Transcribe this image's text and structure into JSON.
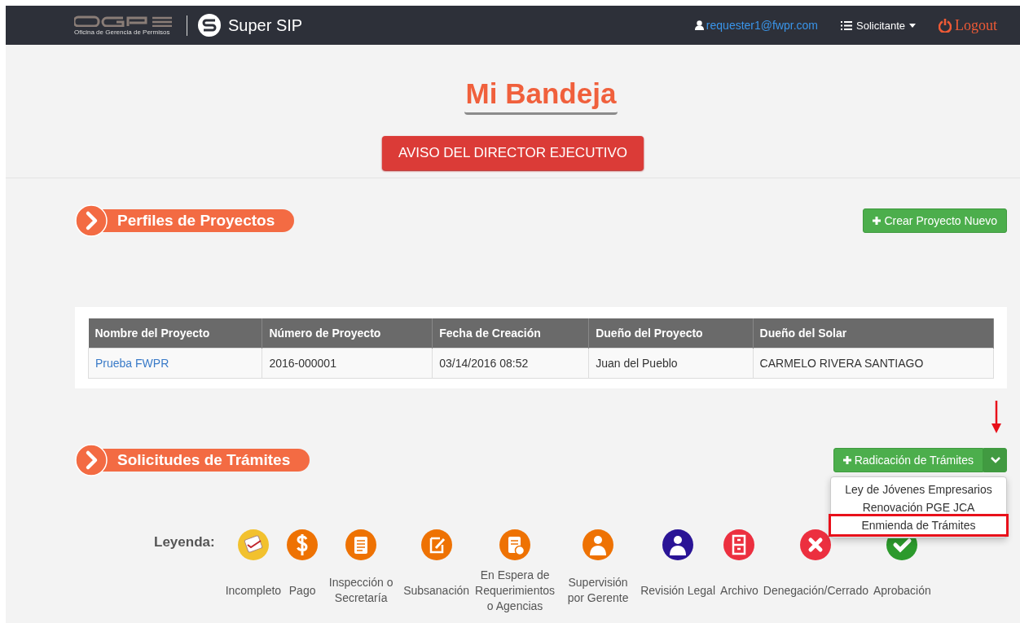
{
  "navbar": {
    "org_name": "Oficina de Gerencia de Permisos",
    "app_name": "Super SIP",
    "user": "requester1@fwpr.com",
    "role": "Solicitante",
    "logout": "Logout"
  },
  "page_title": "Mi Bandeja",
  "notice_button": "AVISO DEL DIRECTOR EJECUTIVO",
  "projects": {
    "heading": "Perfiles de Proyectos",
    "create_button": "Crear Proyecto Nuevo",
    "table": {
      "columns": [
        "Nombre del Proyecto",
        "Número de Proyecto",
        "Fecha de Creación",
        "Dueño del Proyecto",
        "Dueño del Solar"
      ],
      "rows": [
        [
          "Prueba FWPR",
          "2016-000001",
          "03/14/2016 08:52",
          "Juan del Pueblo",
          "CARMELO RIVERA SANTIAGO"
        ]
      ]
    }
  },
  "requests": {
    "heading": "Solicitudes de Trámites",
    "file_button": "Radicación de Trámites",
    "menu_open": true,
    "menu_items": [
      {
        "label": "Ley de Jóvenes Empresarios",
        "highlighted": false
      },
      {
        "label": "Renovación PGE JCA",
        "highlighted": false
      },
      {
        "label": "Enmienda de Trámites",
        "highlighted": true
      }
    ]
  },
  "legend": {
    "title": "Leyenda:",
    "items": [
      {
        "label": "Incompleto",
        "kind": "checklist",
        "color": "#f2c12e"
      },
      {
        "label": "Pago",
        "kind": "dollar",
        "color": "#ee7203"
      },
      {
        "label": "Inspección o Secretaría",
        "kind": "clipboard",
        "color": "#ee7203"
      },
      {
        "label": "Subsanación",
        "kind": "edit",
        "color": "#ee7203"
      },
      {
        "label": "En Espera de Requerimientos o Agencias",
        "kind": "clock",
        "color": "#ee7203"
      },
      {
        "label": "Supervisión por Gerente",
        "kind": "person",
        "color": "#ee7203"
      },
      {
        "label": "Revisión Legal",
        "kind": "person",
        "color": "#2a1496"
      },
      {
        "label": "Archivo",
        "kind": "cabinet",
        "color": "#ec2f3f"
      },
      {
        "label": "Denegación/Cerrado",
        "kind": "cross",
        "color": "#ec2f3f"
      },
      {
        "label": "Aprobación",
        "kind": "check",
        "color": "#2c9a2c"
      }
    ]
  }
}
